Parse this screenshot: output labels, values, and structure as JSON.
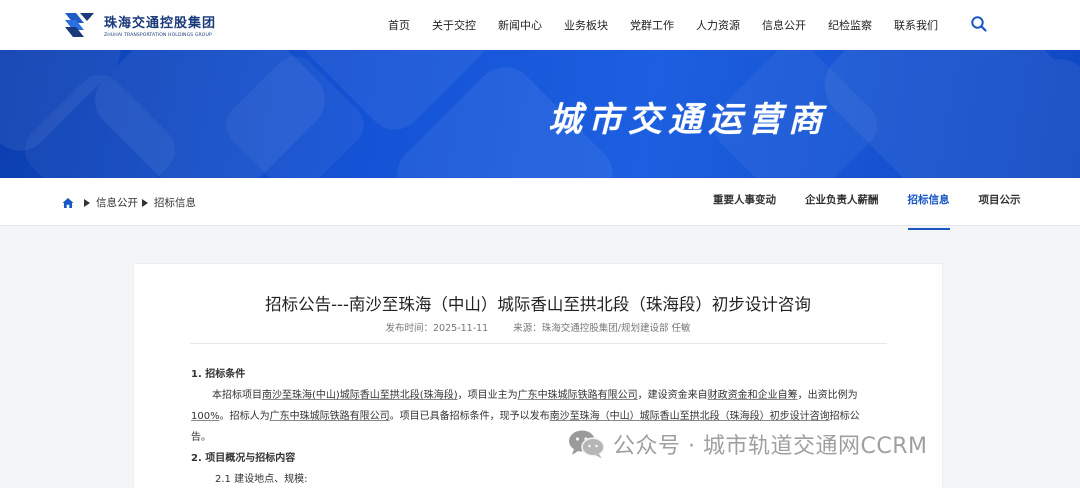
{
  "header": {
    "logo_cn": "珠海交通控股集团",
    "logo_en": "ZHUHAI TRANSPORTATION HOLDINGS GROUP",
    "nav": [
      "首页",
      "关于交控",
      "新闻中心",
      "业务板块",
      "党群工作",
      "人力资源",
      "信息公开",
      "纪检监察",
      "联系我们"
    ],
    "search_icon": "search-icon"
  },
  "banner": {
    "title": "城市交通运营商"
  },
  "breadcrumb": {
    "home_icon": "home-icon",
    "items": [
      "信息公开",
      "招标信息"
    ]
  },
  "subnav": {
    "items": [
      "重要人事变动",
      "企业负责人薪酬",
      "招标信息",
      "项目公示"
    ],
    "active": "招标信息"
  },
  "article": {
    "title": "招标公告---南沙至珠海（中山）城际香山至拱北段（珠海段）初步设计咨询",
    "publish_time": "发布时间：2025-11-11",
    "source": "来源：珠海交通控股集团/规划建设部 任敏",
    "sec1_title": "1. 招标条件",
    "p1_a": "本招标项目",
    "p1_b": "南沙至珠海(中山)城际香山至拱北段(珠海段)",
    "p1_c": "，项目业主为",
    "p1_d": "广东中珠城际铁路有限公司",
    "p1_e": "，建设资金来自",
    "p1_f": "财政资金和企业自筹",
    "p1_g": "，出资比例为",
    "p2_a": "100%",
    "p2_b": "。招标人为",
    "p2_c": "广东中珠城际铁路有限公司",
    "p2_d": "。项目已具备招标条件，现予以发布",
    "p2_e": "南沙至珠海（中山）城际香山至拱北段（珠海段）初步设计咨询",
    "p2_f": "招标公",
    "p3": "告。",
    "sec2_title": "2. 项目概况与招标内容",
    "sec2_1": "2.1 建设地点、规模:"
  },
  "watermark": {
    "text": "公众号 · 城市轨道交通网CCRM",
    "icon": "wechat-icon"
  },
  "colors": {
    "brand": "#1a3a7a",
    "accent": "#1757c6",
    "banner": "#1553d6"
  }
}
